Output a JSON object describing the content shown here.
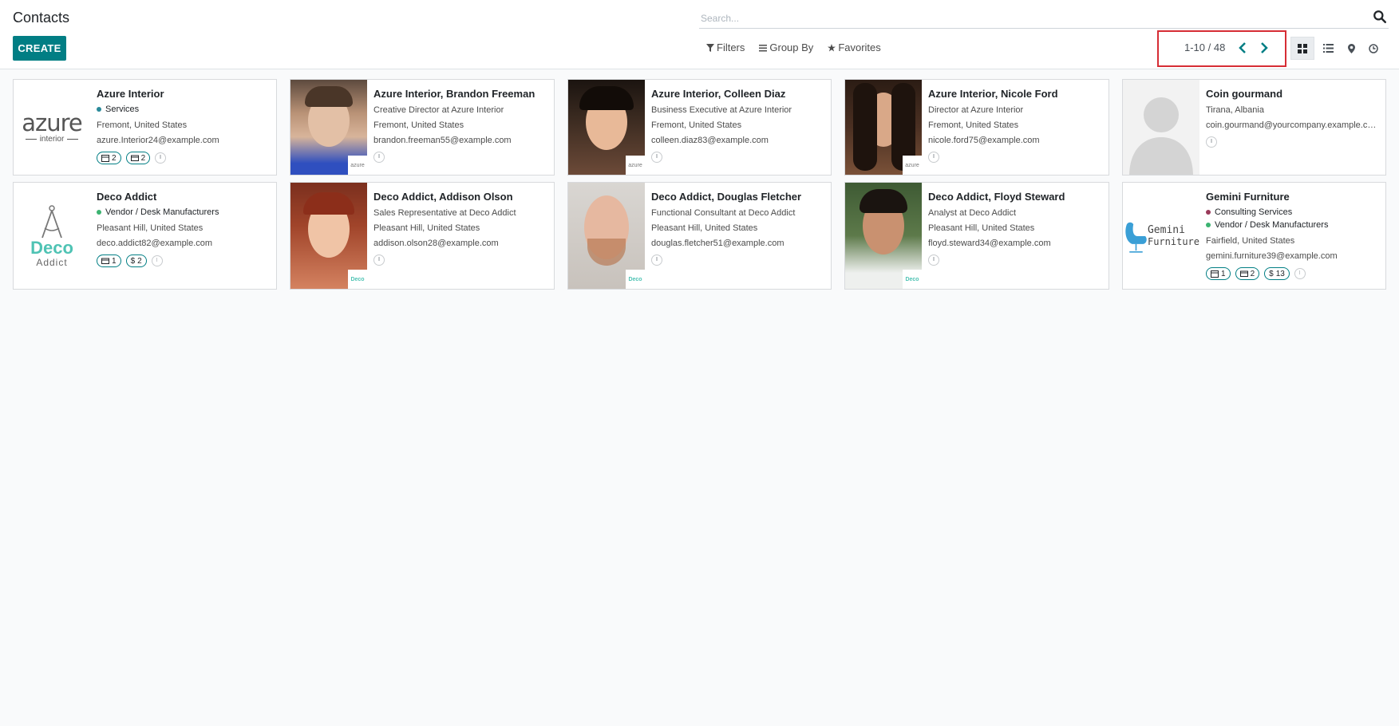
{
  "header": {
    "title": "Contacts",
    "create_label": "CREATE",
    "search_placeholder": "Search..."
  },
  "filters": {
    "filters_label": "Filters",
    "groupby_label": "Group By",
    "favorites_label": "Favorites"
  },
  "pager": {
    "value": "1-10 / 48"
  },
  "views": [
    "kanban-view",
    "list-view",
    "map-view",
    "activity-view"
  ],
  "cards": [
    {
      "name": "Azure Interior",
      "tags": [
        {
          "label": "Services",
          "color": "#2a8a9a"
        }
      ],
      "lines": [
        "Fremont, United States",
        "azure.Interior24@example.com"
      ],
      "badges": [
        "2",
        "2"
      ]
    },
    {
      "name": "Azure Interior, Brandon Freeman",
      "lines": [
        "Creative Director at Azure Interior",
        "Fremont, United States",
        "brandon.freeman55@example.com"
      ]
    },
    {
      "name": "Azure Interior, Colleen Diaz",
      "lines": [
        "Business Executive at Azure Interior",
        "Fremont, United States",
        "colleen.diaz83@example.com"
      ]
    },
    {
      "name": "Azure Interior, Nicole Ford",
      "lines": [
        "Director at Azure Interior",
        "Fremont, United States",
        "nicole.ford75@example.com"
      ]
    },
    {
      "name": "Coin gourmand",
      "lines": [
        "Tirana, Albania",
        "coin.gourmand@yourcompany.example.com"
      ]
    },
    {
      "name": "Deco Addict",
      "tags": [
        {
          "label": "Vendor / Desk Manufacturers",
          "color": "#3cb371"
        }
      ],
      "lines": [
        "Pleasant Hill, United States",
        "deco.addict82@example.com"
      ],
      "badges": [
        "1",
        "2"
      ]
    },
    {
      "name": "Deco Addict, Addison Olson",
      "lines": [
        "Sales Representative at Deco Addict",
        "Pleasant Hill, United States",
        "addison.olson28@example.com"
      ]
    },
    {
      "name": "Deco Addict, Douglas Fletcher",
      "lines": [
        "Functional Consultant at Deco Addict",
        "Pleasant Hill, United States",
        "douglas.fletcher51@example.com"
      ]
    },
    {
      "name": "Deco Addict, Floyd Steward",
      "lines": [
        "Analyst at Deco Addict",
        "Pleasant Hill, United States",
        "floyd.steward34@example.com"
      ]
    },
    {
      "name": "Gemini Furniture",
      "tags": [
        {
          "label": "Consulting Services",
          "color": "#9a3a5a"
        },
        {
          "label": "Vendor / Desk Manufacturers",
          "color": "#3cb371"
        }
      ],
      "lines": [
        "Fairfield, United States",
        "gemini.furniture39@example.com"
      ],
      "badges": [
        "1",
        "2",
        "13"
      ]
    }
  ],
  "logos": {
    "azure": "azure",
    "azure_sub": "interior",
    "deco": "Deco",
    "deco_sub": "Addict",
    "gemini": "Gemini",
    "gemini_sub": "Furniture"
  },
  "colors": {
    "primary": "#017e84",
    "highlight": "#d62d35"
  }
}
